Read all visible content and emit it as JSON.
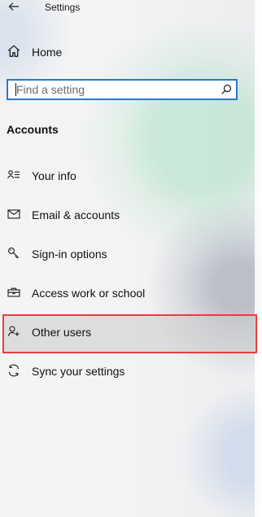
{
  "window": {
    "title": "Settings"
  },
  "navigation": {
    "home_label": "Home"
  },
  "search": {
    "placeholder": "Find a setting",
    "value": ""
  },
  "section": {
    "heading": "Accounts",
    "items": [
      {
        "label": "Your info",
        "icon": "your-info-icon",
        "selected": false
      },
      {
        "label": "Email & accounts",
        "icon": "mail-icon",
        "selected": false
      },
      {
        "label": "Sign-in options",
        "icon": "key-icon",
        "selected": false
      },
      {
        "label": "Access work or school",
        "icon": "briefcase-icon",
        "selected": false
      },
      {
        "label": "Other users",
        "icon": "person-add-icon",
        "selected": true
      },
      {
        "label": "Sync your settings",
        "icon": "sync-icon",
        "selected": false
      }
    ]
  },
  "colors": {
    "focus_outline": "#2b78c7",
    "selection_highlight": "#ea3d3d",
    "selected_background": "#cbcbcb"
  }
}
